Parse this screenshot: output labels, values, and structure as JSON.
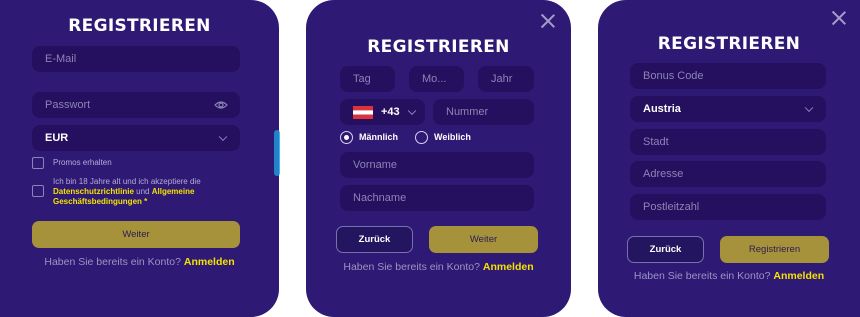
{
  "panel1": {
    "title": "REGISTRIEREN",
    "email_placeholder": "E-Mail",
    "password_placeholder": "Passwort",
    "currency_value": "EUR",
    "promo_label": "Promos erhalten",
    "terms_prefix": "Ich bin 18 Jahre alt und ich akzeptiere die",
    "terms_privacy_link": "Datenschutzrichtlinie",
    "terms_and": "und",
    "terms_general_link": "Allgemeine",
    "terms_general_link2": "Geschäftsbedingungen",
    "terms_required": "*",
    "next_button": "Weiter",
    "have_account": "Haben Sie bereits ein Konto?",
    "login_link": "Anmelden"
  },
  "panel2": {
    "title": "REGISTRIEREN",
    "day_placeholder": "Tag",
    "month_placeholder": "Mo...",
    "year_placeholder": "Jahr",
    "phone_code": "+43",
    "phone_placeholder": "Nummer",
    "gender_male": "Männlich",
    "gender_female": "Weiblich",
    "gender_selected": "male",
    "firstname_placeholder": "Vorname",
    "lastname_placeholder": "Nachname",
    "back_button": "Zurück",
    "next_button": "Weiter",
    "have_account": "Haben Sie bereits ein Konto?",
    "login_link": "Anmelden"
  },
  "panel3": {
    "title": "REGISTRIEREN",
    "bonus_placeholder": "Bonus Code",
    "country_value": "Austria",
    "city_placeholder": "Stadt",
    "address_placeholder": "Adresse",
    "zip_placeholder": "Postleitzahl",
    "back_button": "Zurück",
    "register_button": "Registrieren",
    "have_account": "Haben Sie bereits ein Konto?",
    "login_link": "Anmelden"
  },
  "colors": {
    "panel_bg": "#2e1a74",
    "field_bg": "#24105e",
    "accent_yellow": "#f4e200",
    "gold_button": "#a6923a"
  }
}
